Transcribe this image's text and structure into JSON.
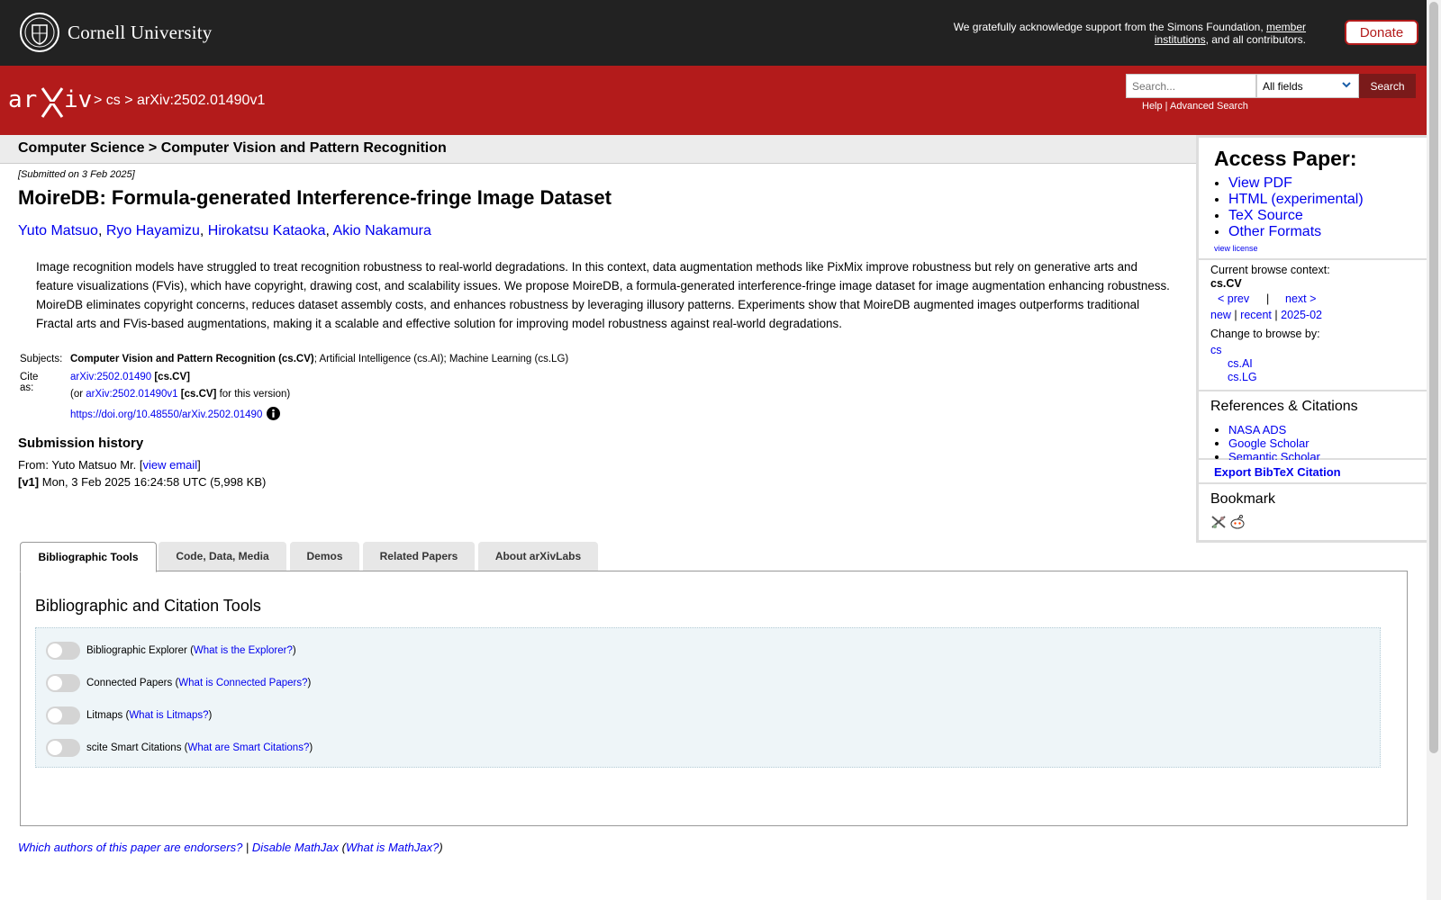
{
  "top": {
    "university": "Cornell University",
    "ack_prefix": "We gratefully acknowledge support from the Simons Foundation, ",
    "ack_link": "member institutions",
    "ack_suffix": ", and all contributors.",
    "donate_label": "Donate"
  },
  "header": {
    "breadcrumb": "> cs > arXiv:2502.01490v1",
    "search_placeholder": "Search...",
    "field_selected": "All fields",
    "search_label": "Search",
    "help": "Help",
    "sep": " | ",
    "advanced": "Advanced Search"
  },
  "paper": {
    "category_header": "Computer Science > Computer Vision and Pattern Recognition",
    "submitted": "[Submitted on 3 Feb 2025]",
    "title": "MoireDB: Formula-generated Interference-fringe Image Dataset",
    "authors": [
      "Yuto Matsuo",
      "Ryo Hayamizu",
      "Hirokatsu Kataoka",
      "Akio Nakamura"
    ],
    "author_sep": ", ",
    "abstract": "Image recognition models have struggled to treat recognition robustness to real-world degradations. In this context, data augmentation methods like PixMix improve robustness but rely on generative arts and feature visualizations (FVis), which have copyright, drawing cost, and scalability issues. We propose MoireDB, a formula-generated interference-fringe image dataset for image augmentation enhancing robustness. MoireDB eliminates copyright concerns, reduces dataset assembly costs, and enhances robustness by leveraging illusory patterns. Experiments show that MoireDB augmented images outperforms traditional Fractal arts and FVis-based augmentations, making it a scalable and effective solution for improving model robustness against real-world degradations.",
    "subjects_label": "Subjects:",
    "subjects_primary": "Computer Vision and Pattern Recognition (cs.CV)",
    "subjects_rest": "; Artificial Intelligence (cs.AI); Machine Learning (cs.LG)",
    "cite_label": "Cite as:",
    "cite_id": "arXiv:2502.01490",
    "cite_cat": " [cs.CV]",
    "cite_or": "(or ",
    "cite_version": "arXiv:2502.01490v1",
    "cite_version_cat": " [cs.CV]",
    "cite_version_suffix": " for this version)",
    "doi": "https://doi.org/10.48550/arXiv.2502.01490"
  },
  "history": {
    "title": "Submission history",
    "from": "From: Yuto Matsuo Mr. [",
    "view_email": "view email",
    "from_end": "]",
    "v1_label": "[v1]",
    "v1_text": " Mon, 3 Feb 2025 16:24:58 UTC (5,998 KB)"
  },
  "sidebar": {
    "access_title": "Access Paper:",
    "access_links": [
      "View PDF",
      "HTML (experimental)",
      "TeX Source",
      "Other Formats"
    ],
    "view_license": "view license",
    "browse_context_label": "Current browse context:",
    "browse_context": "cs.CV",
    "prev": "< prev",
    "pipe": "|",
    "next": "next >",
    "new": "new",
    "recent": "recent",
    "month": "2025-02",
    "change_browse": "Change to browse by:",
    "browse_cs": "cs",
    "browse_ai": "cs.AI",
    "browse_lg": "cs.LG",
    "refs_title": "References & Citations",
    "refs": [
      "NASA ADS",
      "Google Scholar",
      "Semantic Scholar"
    ],
    "bibtex": "Export BibTeX Citation",
    "bookmark": "Bookmark"
  },
  "tabs": {
    "items": [
      "Bibliographic Tools",
      "Code, Data, Media",
      "Demos",
      "Related Papers",
      "About arXivLabs"
    ],
    "active": "Bibliographic Tools",
    "panel_title": "Bibliographic and Citation Tools",
    "tools": [
      {
        "name": "Bibliographic Explorer",
        "help": "What is the Explorer?"
      },
      {
        "name": "Connected Papers",
        "help": "What is Connected Papers?"
      },
      {
        "name": "Litmaps",
        "help": "What is Litmaps?"
      },
      {
        "name": "scite Smart Citations",
        "help": "What are Smart Citations?"
      }
    ]
  },
  "footer": {
    "endorsers": "Which authors of this paper are endorsers?",
    "sep": " | ",
    "mathjax": "Disable MathJax",
    "what_mathjax": "What is MathJax?"
  },
  "icons": [
    "cornell-seal-icon",
    "arxiv-logo",
    "chevron-down-icon",
    "info-icon",
    "bibsonomy-icon",
    "reddit-icon"
  ],
  "colors": {
    "arxiv_red": "#b31b1b",
    "dark_bar": "#222222",
    "link": "#0000ee"
  }
}
